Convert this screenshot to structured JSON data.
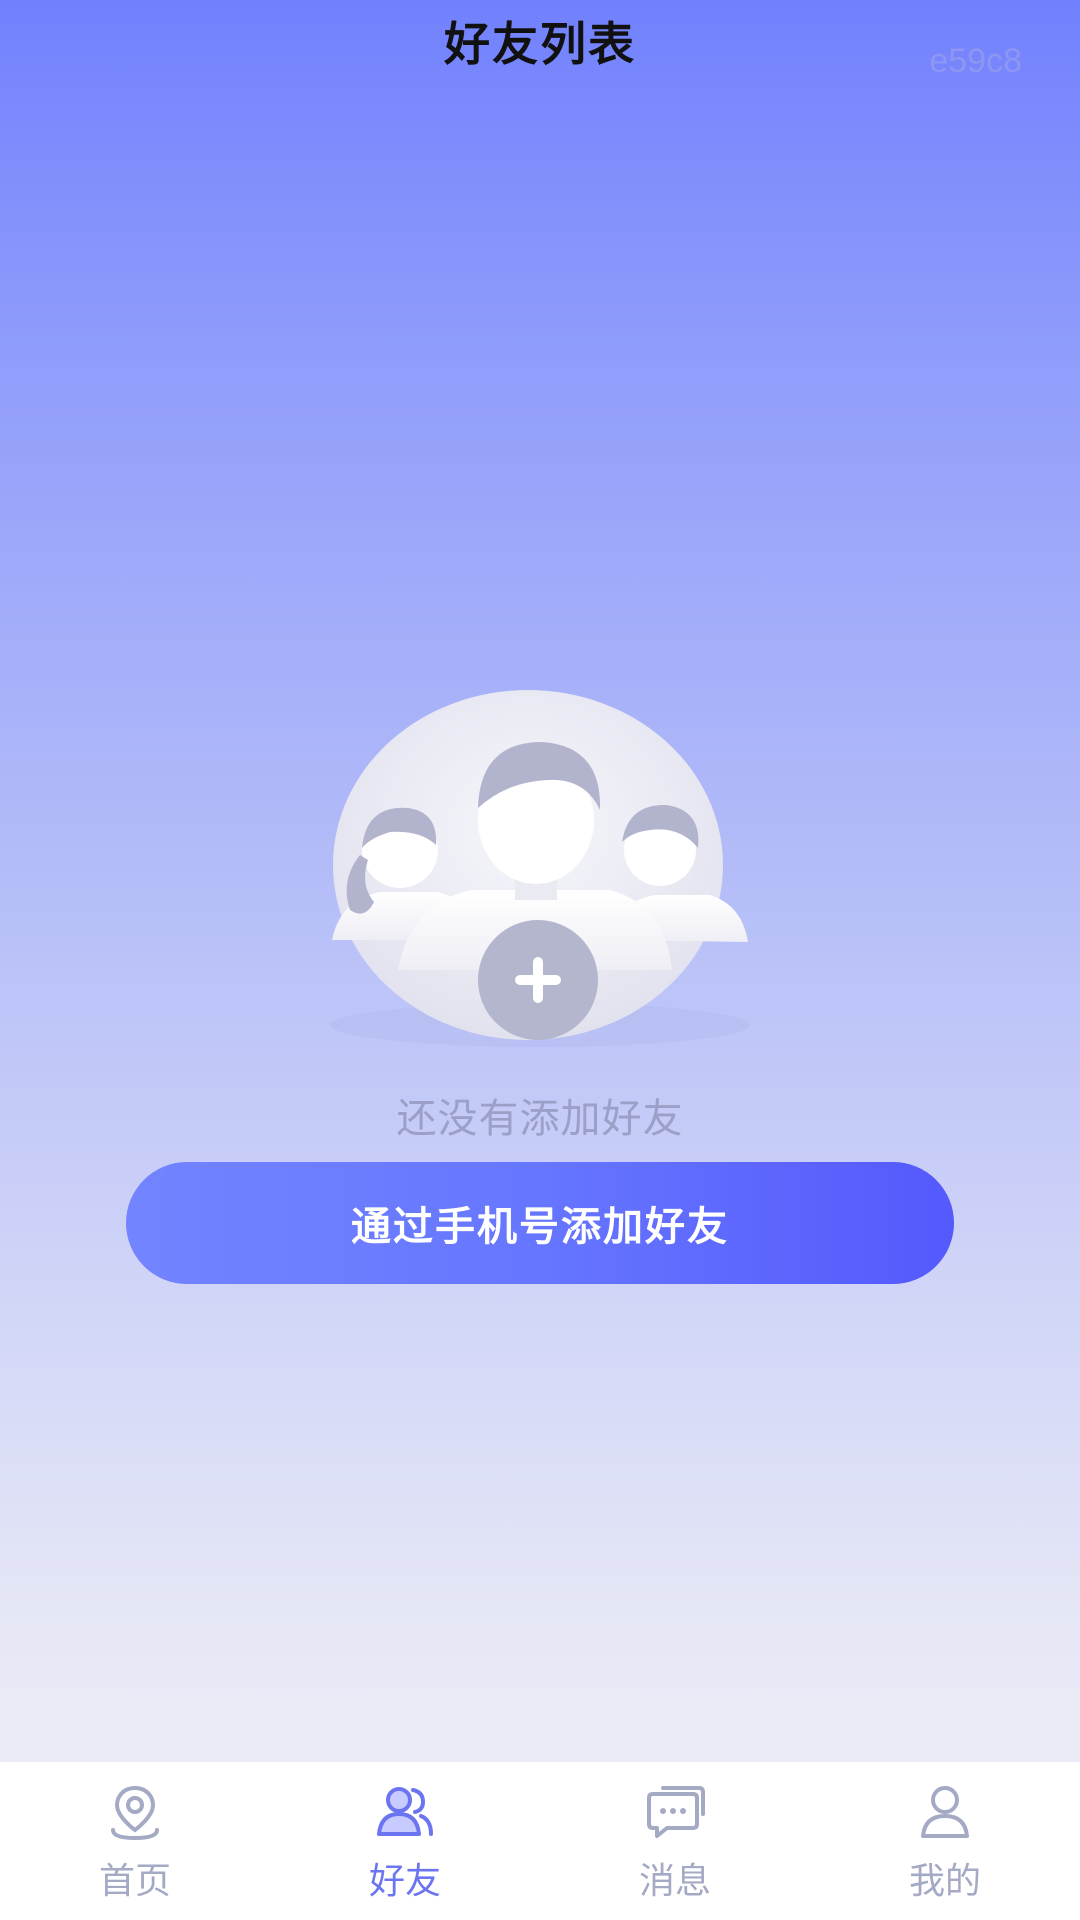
{
  "header": {
    "title": "好友列表",
    "code": "e59c8"
  },
  "empty_state": {
    "illustration_icon": "friends-add-icon",
    "message": "还没有添加好友",
    "button_label": "通过手机号添加好友"
  },
  "tabbar": {
    "active_color": "#6c75f0",
    "inactive_color": "#a4a9c4",
    "items": [
      {
        "label": "首页",
        "icon": "location-pin-icon"
      },
      {
        "label": "好友",
        "icon": "friends-icon",
        "active": true
      },
      {
        "label": "消息",
        "icon": "chat-icon"
      },
      {
        "label": "我的",
        "icon": "person-icon"
      }
    ]
  },
  "colors": {
    "button_start": "#7284ff",
    "button_end": "#5459fc",
    "background_top": "#7181fd",
    "background_bottom": "#efeff6"
  }
}
